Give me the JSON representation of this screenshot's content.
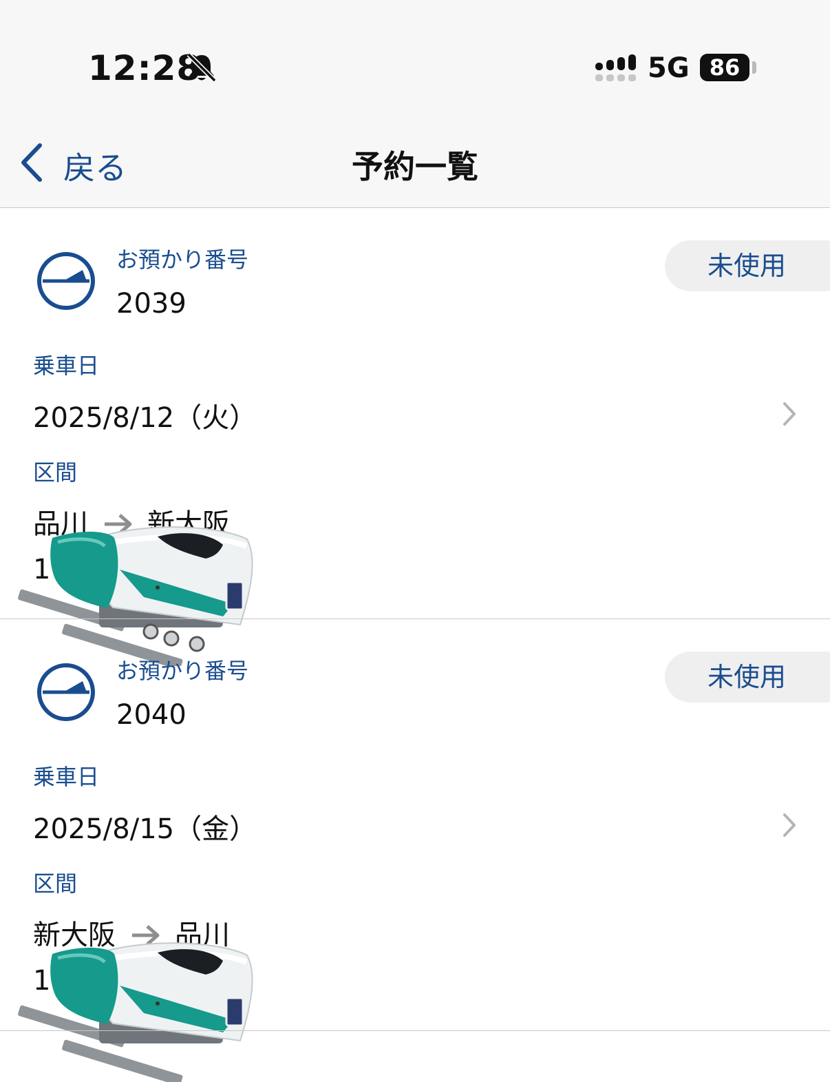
{
  "status_bar": {
    "time": "12:28",
    "network": "5G",
    "battery": "86"
  },
  "nav": {
    "back_label": "戻る",
    "title": "予約一覧"
  },
  "reservations": [
    {
      "number_label": "お預かり番号",
      "number": "2039",
      "status": "未使用",
      "date_label": "乗車日",
      "date": "2025/8/12（火）",
      "section_label": "区間",
      "from": "品川",
      "to": "新大阪",
      "partial": "1"
    },
    {
      "number_label": "お預かり番号",
      "number": "2040",
      "status": "未使用",
      "date_label": "乗車日",
      "date": "2025/8/15（金）",
      "section_label": "区間",
      "from": "新大阪",
      "to": "品川",
      "partial": "1"
    }
  ],
  "colors": {
    "accent": "#1a4d8f",
    "train_green": "#159a8c",
    "badge_bg": "#efefef"
  }
}
